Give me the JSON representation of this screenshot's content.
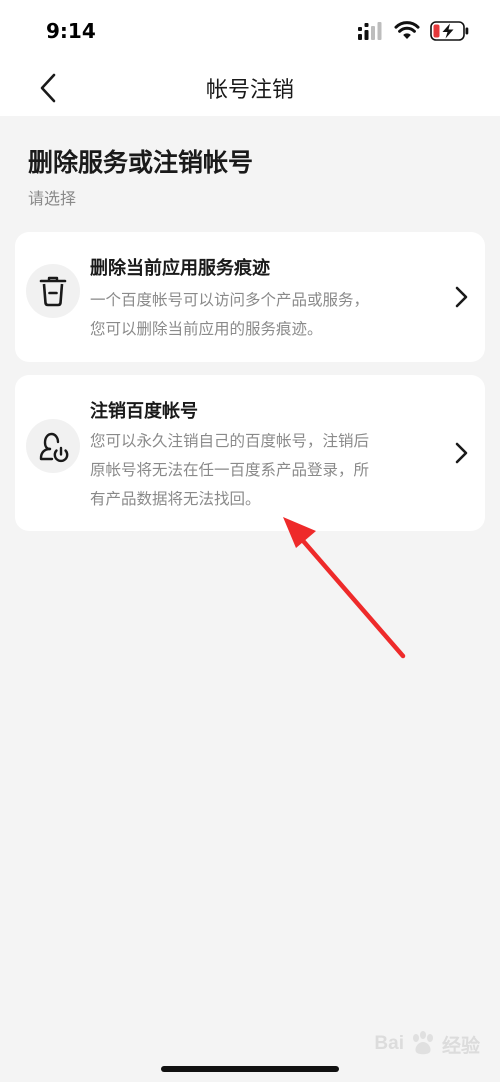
{
  "status_bar": {
    "time": "9:14"
  },
  "nav": {
    "title": "帐号注销"
  },
  "page": {
    "heading": "删除服务或注销帐号",
    "subtitle": "请选择"
  },
  "options": [
    {
      "title": "删除当前应用服务痕迹",
      "description": "一个百度帐号可以访问多个产品或服务，您可以删除当前应用的服务痕迹。",
      "icon": "trash-icon"
    },
    {
      "title": "注销百度帐号",
      "description": "您可以永久注销自己的百度帐号，注销后原帐号将无法在任一百度系产品登录，所有产品数据将无法找回。",
      "icon": "user-power-icon"
    }
  ],
  "watermark": {
    "text_left": "Bai",
    "text_right": "经验"
  },
  "colors": {
    "background": "#f4f4f4",
    "card": "#ffffff",
    "annotation_arrow": "#ee2a2a",
    "battery_low": "#e5383b"
  }
}
